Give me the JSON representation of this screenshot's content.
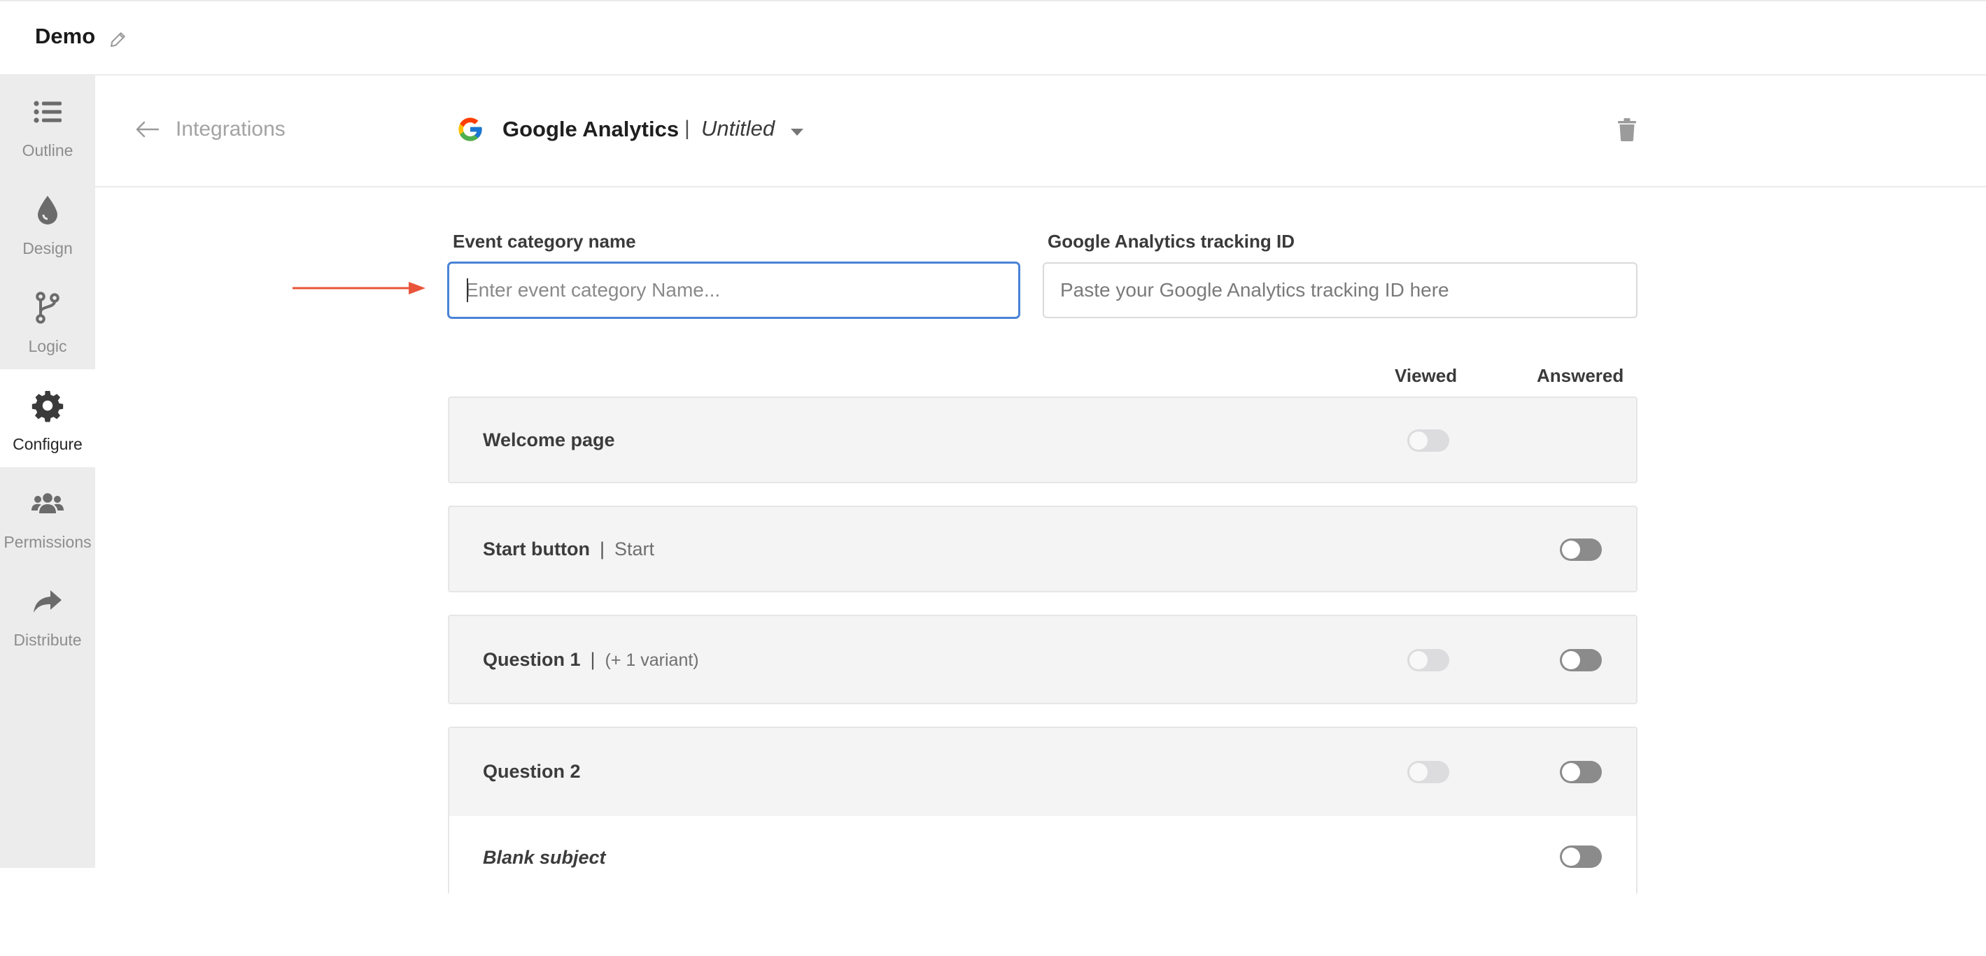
{
  "app": {
    "title": "Demo"
  },
  "sidebar": {
    "items": [
      {
        "label": "Outline",
        "icon": "list-icon",
        "active": false
      },
      {
        "label": "Design",
        "icon": "droplet-icon",
        "active": false
      },
      {
        "label": "Logic",
        "icon": "branch-icon",
        "active": false
      },
      {
        "label": "Configure",
        "icon": "gear-icon",
        "active": true
      },
      {
        "label": "Permissions",
        "icon": "users-icon",
        "active": false
      },
      {
        "label": "Distribute",
        "icon": "share-arrow-icon",
        "active": false
      }
    ]
  },
  "header": {
    "back_label": "Integrations",
    "integration_name": "Google Analytics",
    "separator": "|",
    "integration_title": "Untitled"
  },
  "form": {
    "category": {
      "label": "Event category name",
      "placeholder": "Enter event category Name...",
      "value": ""
    },
    "tracking": {
      "label": "Google Analytics tracking ID",
      "placeholder": "Paste your Google Analytics tracking ID here",
      "value": ""
    }
  },
  "columns": {
    "viewed": "Viewed",
    "answered": "Answered"
  },
  "events": [
    {
      "title": "Welcome page",
      "subtitle": "",
      "viewed": false,
      "answered": null
    },
    {
      "title": "Start button",
      "subtitle": "Start",
      "viewed": null,
      "answered": false
    },
    {
      "title": "Question 1",
      "subtitle": "(+ 1 variant)",
      "viewed": false,
      "answered": false
    },
    {
      "title": "Question 2",
      "subtitle": "",
      "viewed": false,
      "answered": false,
      "sub_item": {
        "title": "Blank subject",
        "answered": false
      }
    }
  ],
  "colors": {
    "accent_focus": "#4a83d6",
    "annotation_arrow": "#e8553a",
    "sidebar_bg": "#ececec",
    "card_bg": "#f4f4f4"
  }
}
